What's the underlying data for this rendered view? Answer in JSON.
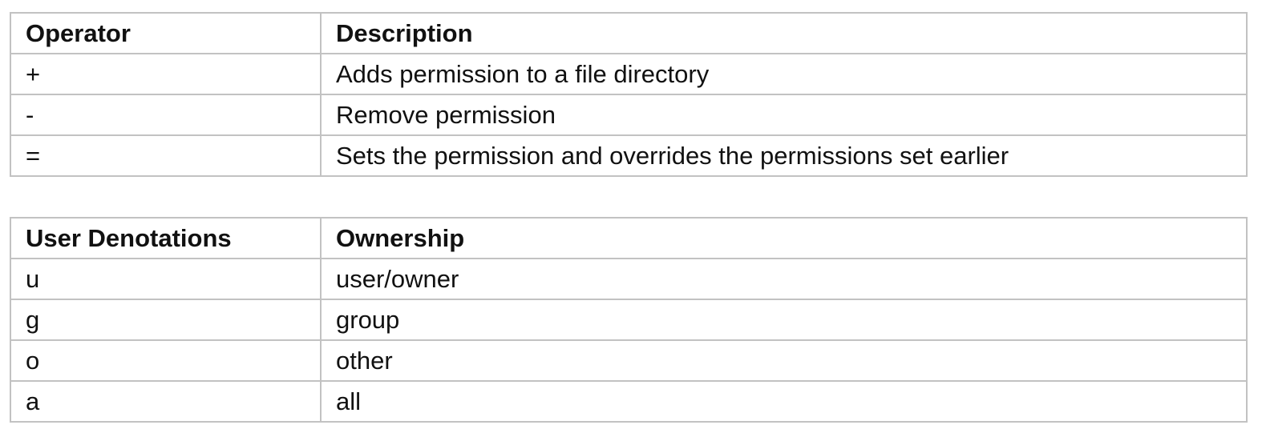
{
  "operators_table": {
    "headers": [
      "Operator",
      "Description"
    ],
    "rows": [
      [
        "+",
        "Adds permission to a file directory"
      ],
      [
        "-",
        "Remove permission"
      ],
      [
        "=",
        "Sets the permission and overrides the permissions set earlier"
      ]
    ]
  },
  "users_table": {
    "headers": [
      "User Denotations",
      "Ownership"
    ],
    "rows": [
      [
        "u",
        "user/owner"
      ],
      [
        "g",
        "group"
      ],
      [
        "o",
        "other"
      ],
      [
        "a",
        "all"
      ]
    ]
  },
  "colors": {
    "border": "#c2c2c2",
    "text": "#111111",
    "background": "#ffffff"
  }
}
